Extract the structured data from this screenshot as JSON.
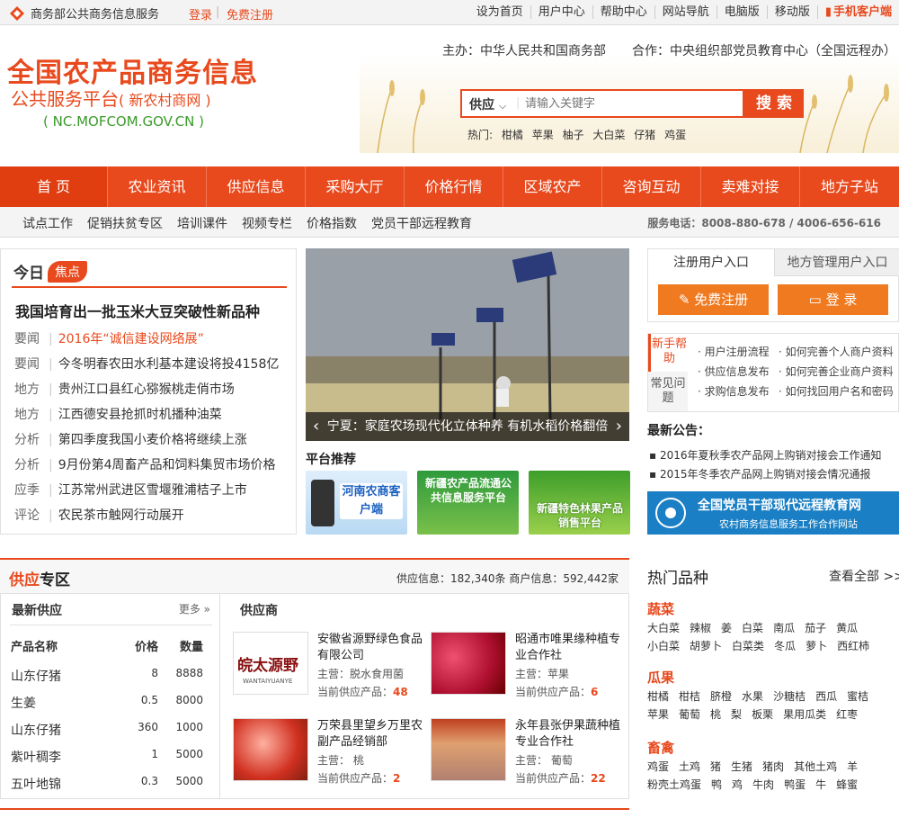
{
  "topbar": {
    "brand": "商务部公共商务信息服务",
    "login": "登录",
    "register": "免费注册",
    "links": [
      "设为首页",
      "用户中心",
      "帮助中心",
      "网站导航",
      "电脑版",
      "移动版",
      "手机客户端"
    ]
  },
  "header": {
    "title1": "全国农产品商务信息",
    "title2": "公共服务平台",
    "title2b": "( 新农村商网 )",
    "domain": "( NC.MOFCOM.GOV.CN )",
    "sponsor": "主办：中华人民共和国商务部",
    "partner": "合作：中央组织部党员教育中心（全国远程办）"
  },
  "search": {
    "category": "供应",
    "placeholder": "请输入关键字",
    "button": "搜 索",
    "hot_label": "热门:",
    "hot": [
      "柑橘",
      "苹果",
      "柚子",
      "大白菜",
      "仔猪",
      "鸡蛋"
    ]
  },
  "nav": [
    "首 页",
    "农业资讯",
    "供应信息",
    "采购大厅",
    "价格行情",
    "区域农产",
    "咨询互动",
    "卖难对接",
    "地方子站"
  ],
  "subnav": {
    "items": [
      "试点工作",
      "促销扶贫专区",
      "培训课件",
      "视频专栏",
      "价格指数",
      "党员干部远程教育"
    ],
    "phone": "服务电话：8008-880-678 / 4006-656-616"
  },
  "today": {
    "title_a": "今日",
    "title_b": "焦点",
    "headline": "我国培育出一批玉米大豆突破性新品种",
    "items": [
      {
        "cat": "要闻",
        "text": "2016年“诚信建设网络展”",
        "red": true
      },
      {
        "cat": "要闻",
        "text": "今冬明春农田水利基本建设将投4158亿"
      },
      {
        "cat": "地方",
        "text": "贵州江口县红心猕猴桃走俏市场"
      },
      {
        "cat": "地方",
        "text": "江西德安县抢抓时机播种油菜"
      },
      {
        "cat": "分析",
        "text": "第四季度我国小麦价格将继续上涨"
      },
      {
        "cat": "分析",
        "text": "9月份第4周畜产品和饲料集贸市场价格"
      },
      {
        "cat": "应季",
        "text": "江苏常州武进区雪堰雅浦桔子上市"
      },
      {
        "cat": "评论",
        "text": "农民茶市触网行动展开"
      }
    ]
  },
  "slide": {
    "caption": "宁夏：家庭农场现代化立体种养  有机水稻价格翻倍"
  },
  "platform": {
    "title": "平台推荐",
    "items": [
      "河南农商客户端",
      "新疆农产品流通公共信息服务平台",
      "新疆特色林果产品销售平台"
    ]
  },
  "login": {
    "tab1": "注册用户入口",
    "tab2": "地方管理用户入口",
    "reg": "免费注册",
    "login": "登 录"
  },
  "help": {
    "tab1": "新手帮助",
    "tab2": "常见问题",
    "links": [
      "用户注册流程",
      "如何完善个人商户资料",
      "供应信息发布",
      "如何完善企业商户资料",
      "求购信息发布",
      "如何找回用户名和密码"
    ]
  },
  "notice": {
    "title": "最新公告：",
    "items": [
      "2016年夏秋季农产品网上购销对接会工作通知",
      "2015年冬季农产品网上购销对接会情况通报"
    ]
  },
  "banner": {
    "line1": "全国党员干部现代远程教育网",
    "line2": "农村商务信息服务工作合作网站"
  },
  "supply": {
    "title_a": "供应",
    "title_b": "专区",
    "stats": "供应信息：182,340条  商户信息：592,442家",
    "latest_title": "最新供应",
    "more": "更多",
    "columns": [
      "产品名称",
      "价格",
      "数量"
    ],
    "rows": [
      [
        "山东仔猪",
        "8",
        "8888"
      ],
      [
        "生姜",
        "0.5",
        "8000"
      ],
      [
        "山东仔猪",
        "360",
        "1000"
      ],
      [
        "紫叶稠李",
        "1",
        "5000"
      ],
      [
        "五叶地锦",
        "0.3",
        "5000"
      ]
    ],
    "supplier_title": "供应商",
    "suppliers": [
      {
        "name": "安徽省源野绿色食品有限公司",
        "biz": "主营：脱水食用菌",
        "cur_label": "当前供应产品：",
        "count": "48",
        "logo": "皖太源野",
        "logo_sub": "WANTAIYUANYE"
      },
      {
        "name": "昭通市唯果缘种植专业合作社",
        "biz": "主营：苹果",
        "cur_label": "当前供应产品：",
        "count": "6"
      },
      {
        "name": "万荣县里望乡万里农副产品经销部",
        "biz": "主营： 桃",
        "cur_label": "当前供应产品：",
        "count": "2"
      },
      {
        "name": "永年县张伊果蔬种植专业合作社",
        "biz": "主营： 葡萄",
        "cur_label": "当前供应产品：",
        "count": "22"
      }
    ]
  },
  "hotv": {
    "title": "热门品种",
    "all": "查看全部 >>",
    "cats": [
      {
        "name": "蔬菜",
        "items": [
          "大白菜",
          "辣椒",
          "姜",
          "白菜",
          "南瓜",
          "茄子",
          "黄瓜",
          "小白菜",
          "胡萝卜",
          "白菜类",
          "冬瓜",
          "萝卜",
          "西红柿"
        ]
      },
      {
        "name": "瓜果",
        "items": [
          "柑橘",
          "柑桔",
          "脐橙",
          "水果",
          "沙糖桔",
          "西瓜",
          "蜜桔",
          "苹果",
          "葡萄",
          "桃",
          "梨",
          "板栗",
          "果用瓜类",
          "红枣"
        ]
      },
      {
        "name": "畜禽",
        "items": [
          "鸡蛋",
          "土鸡",
          "猪",
          "生猪",
          "猪肉",
          "其他土鸡",
          "羊",
          "粉壳土鸡蛋",
          "鸭",
          "鸡",
          "牛肉",
          "鸭蛋",
          "牛",
          "蜂蜜"
        ]
      }
    ]
  },
  "colors": {
    "accent": "#e8491d",
    "green": "#3a9a2a",
    "blue": "#1a7fc4"
  }
}
